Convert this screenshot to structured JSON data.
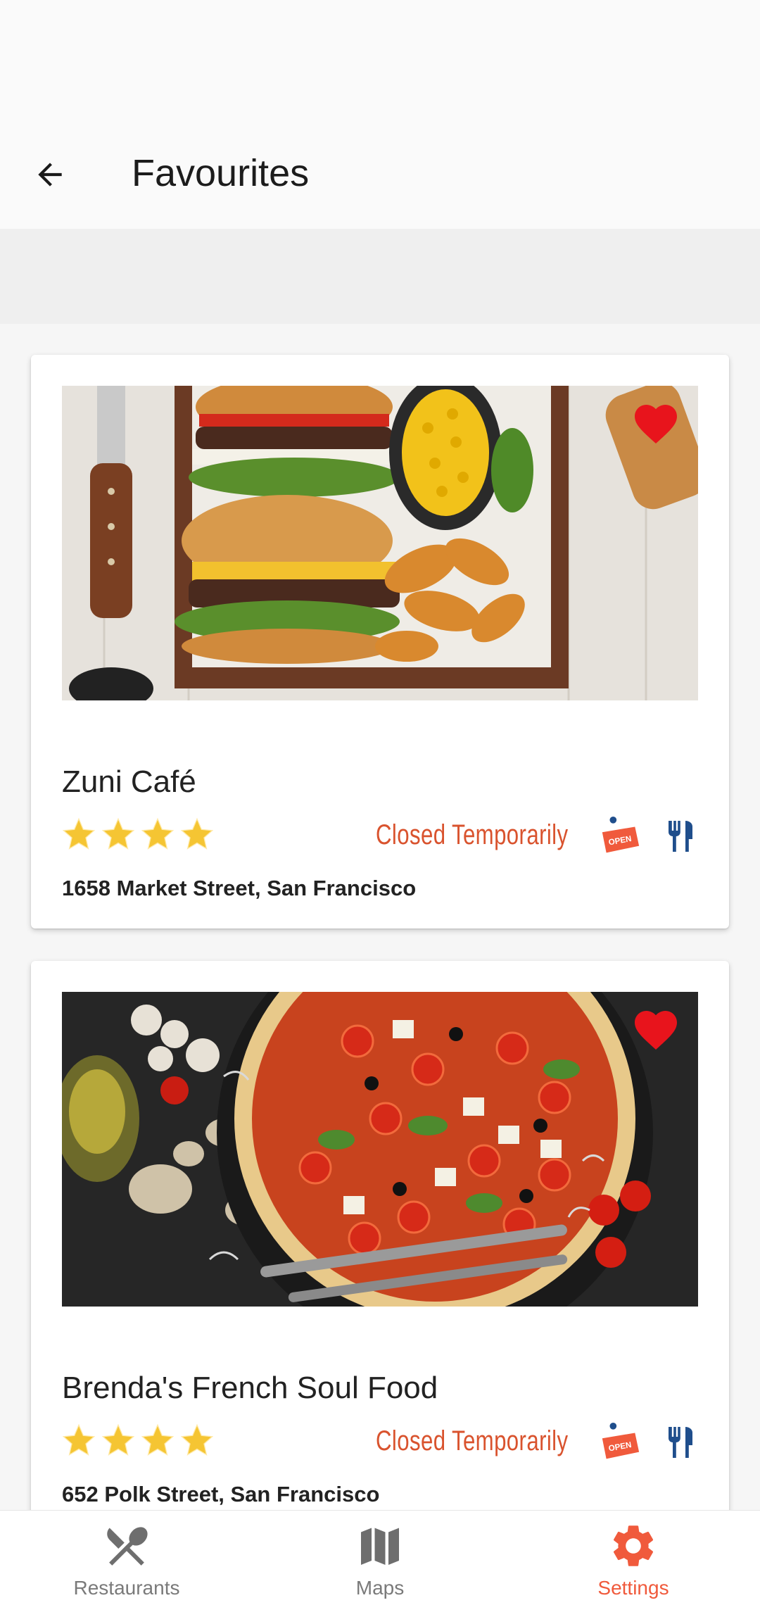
{
  "app_bar": {
    "title": "Favourites"
  },
  "restaurants": [
    {
      "name": "Zuni Café",
      "rating": 4,
      "status": "Closed Temporarily",
      "address": "1658 Market Street, San Francisco",
      "favourite": true,
      "photo": "burger-and-fries"
    },
    {
      "name": "Brenda's French Soul Food",
      "rating": 4,
      "status": "Closed Temporarily",
      "address": "652 Polk Street, San Francisco",
      "favourite": true,
      "photo": "pizza"
    }
  ],
  "bottom_nav": {
    "items": [
      {
        "label": "Restaurants",
        "icon": "fork-knife-icon",
        "active": false
      },
      {
        "label": "Maps",
        "icon": "map-icon",
        "active": false
      },
      {
        "label": "Settings",
        "icon": "gear-icon",
        "active": true
      }
    ]
  },
  "colors": {
    "accent": "#f05a3c",
    "status_text": "#d9532e",
    "heart": "#e8141c",
    "star": "#f5c533",
    "cutlery": "#1f4e8c"
  }
}
